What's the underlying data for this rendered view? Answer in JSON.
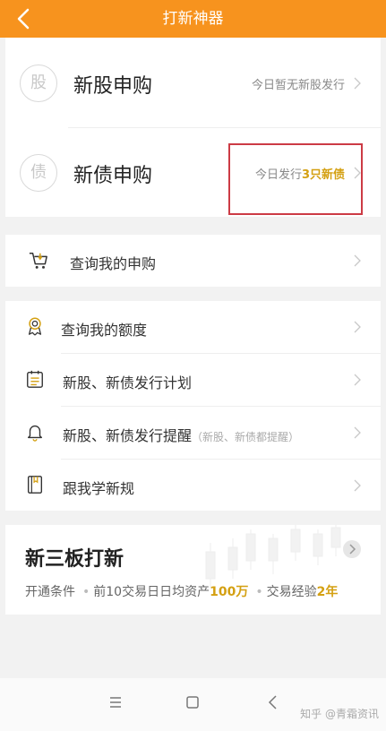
{
  "header": {
    "title": "打新神器"
  },
  "subscription": {
    "stock": {
      "icon_char": "股",
      "title": "新股申购",
      "note": "今日暂无新股发行"
    },
    "bond": {
      "icon_char": "债",
      "title": "新债申购",
      "note_prefix": "今日发行",
      "note_highlight": "3只新债"
    }
  },
  "query": {
    "label": "查询我的申购"
  },
  "menu": {
    "quota": {
      "label": "查询我的额度"
    },
    "plan": {
      "label": "新股、新债发行计划"
    },
    "reminder": {
      "label": "新股、新债发行提醒",
      "hint": "（新股、新债都提醒）"
    },
    "learn": {
      "label": "跟我学新规"
    }
  },
  "neeq": {
    "title": "新三板打新",
    "condition_label": "开通条件",
    "cond1_prefix": "前10交易日日均资产",
    "cond1_value": "100万",
    "cond2_prefix": "交易经验",
    "cond2_value": "2年"
  },
  "watermark": "知乎 @青霜资讯",
  "colors": {
    "header": "#f7931e",
    "gold": "#d4a012",
    "highlight_box": "#cc3b45"
  }
}
